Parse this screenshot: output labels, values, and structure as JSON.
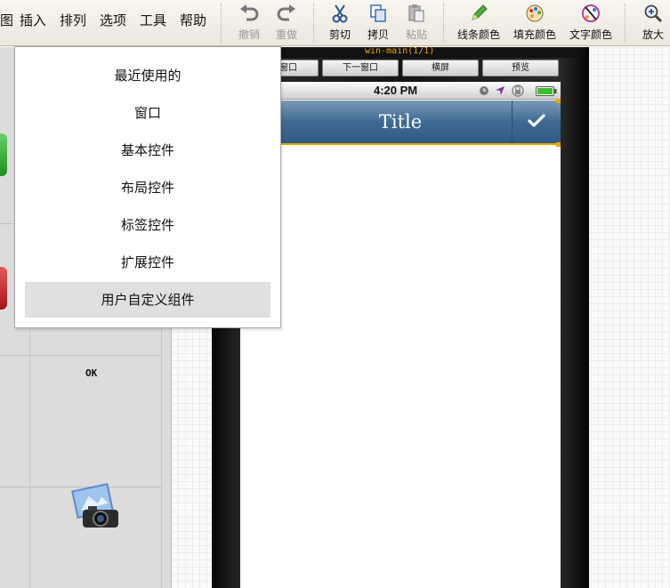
{
  "menu_bar": {
    "items": [
      "图",
      "插入",
      "排列",
      "选项",
      "工具",
      "帮助"
    ]
  },
  "toolbar": {
    "undo": "撤销",
    "redo": "重做",
    "cut": "剪切",
    "copy": "拷贝",
    "paste": "粘贴",
    "line_color": "线条颜色",
    "fill_color": "填充颜色",
    "text_color": "文字颜色",
    "zoom_in": "放大"
  },
  "dropdown": {
    "items": [
      "最近使用的",
      "窗口",
      "基本控件",
      "布局控件",
      "标签控件",
      "扩展控件",
      "用户自定义组件"
    ],
    "active_index": 6
  },
  "palette": {
    "ok_label": "OK"
  },
  "phone": {
    "window_label": "win-main(1/1)",
    "buttons": [
      "窗口",
      "下一窗口",
      "横屏",
      "预览"
    ],
    "status_time": "4:20 PM",
    "nav_title": "Title"
  },
  "colors": {
    "nav_bar": "#3f6a92",
    "selection": "#e6a800",
    "dropdown_active": "#e0e0e0"
  }
}
